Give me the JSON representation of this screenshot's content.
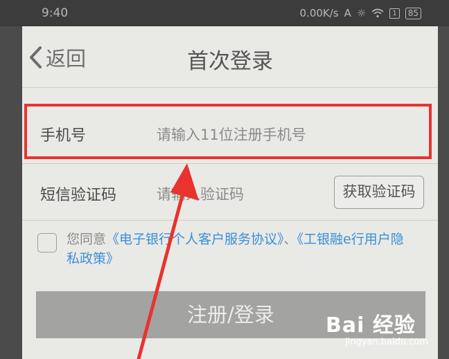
{
  "status_bar": {
    "time": "9:40",
    "speed": "0.00K/s",
    "sim": "1",
    "battery": "85"
  },
  "header": {
    "back_label": "返回",
    "title": "首次登录"
  },
  "form": {
    "phone_label": "手机号",
    "phone_placeholder": "请输入11位注册手机号",
    "sms_label": "短信验证码",
    "sms_placeholder": "请输入验证码",
    "get_code_button": "获取验证码"
  },
  "agreement": {
    "prefix": "您同意",
    "link1": "《电子银行个人客户服务协议》",
    "separator": "、",
    "link2": "《工银融e行用户隐私政策》"
  },
  "submit_label": "注册/登录",
  "watermark": {
    "brand": "Bai 经验",
    "url": "jingyan.baidu.com"
  },
  "colors": {
    "highlight": "#e8332f",
    "link": "#3a8fd6",
    "button_disabled": "#a3a3a1"
  }
}
